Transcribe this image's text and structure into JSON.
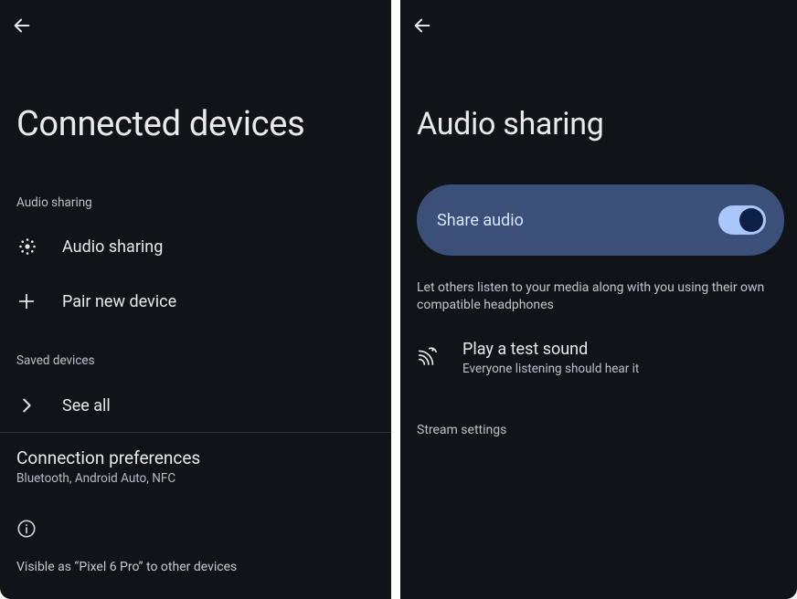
{
  "left": {
    "title": "Connected devices",
    "sections": {
      "audio": "Audio sharing",
      "saved": "Saved devices"
    },
    "rows": {
      "audio_sharing": "Audio sharing",
      "pair_new": "Pair new device",
      "see_all": "See all"
    },
    "preferences": {
      "title": "Connection preferences",
      "subtitle": "Bluetooth, Android Auto, NFC"
    },
    "visibility": "Visible as “Pixel 6 Pro” to other devices"
  },
  "right": {
    "title": "Audio sharing",
    "share_card": {
      "label": "Share audio",
      "toggle_on": true
    },
    "share_description": "Let others listen to your media along with you using their own compatible headphones",
    "test_sound": {
      "title": "Play a test sound",
      "subtitle": "Everyone listening should hear it"
    },
    "stream_label": "Stream settings"
  }
}
